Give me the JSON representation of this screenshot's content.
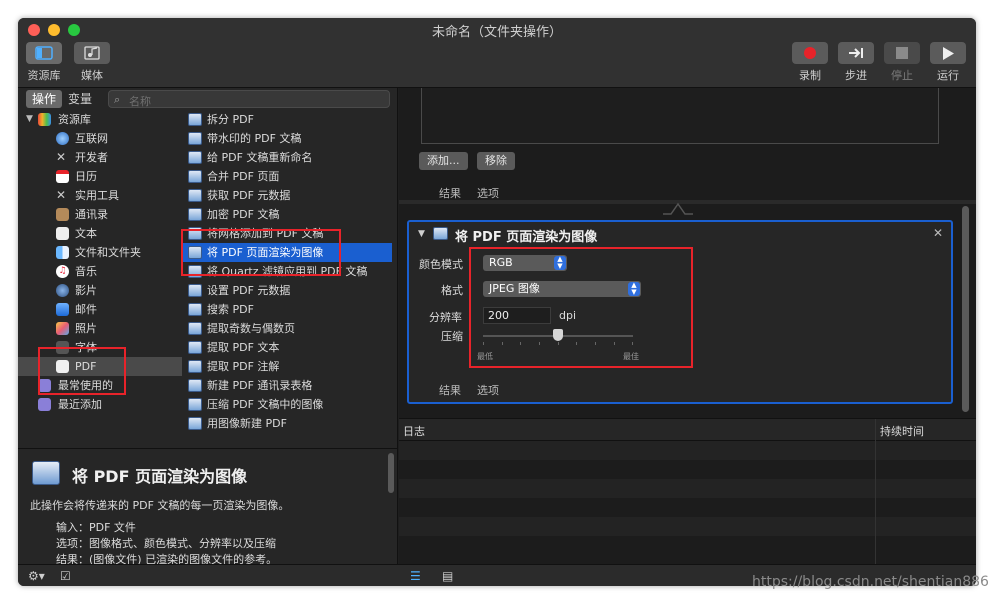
{
  "window": {
    "title": "未命名（文件夹操作）"
  },
  "toolbar": {
    "library_label": "资源库",
    "media_label": "媒体",
    "record_label": "录制",
    "step_label": "步进",
    "stop_label": "停止",
    "run_label": "运行"
  },
  "library": {
    "tab_actions": "操作",
    "tab_variables": "变量",
    "search_placeholder": "名称",
    "categories": [
      {
        "label": "资源库",
        "icon": "library-icon"
      },
      {
        "label": "互联网",
        "icon": "globe-icon"
      },
      {
        "label": "开发者",
        "icon": "tools-icon"
      },
      {
        "label": "日历",
        "icon": "calendar-icon"
      },
      {
        "label": "实用工具",
        "icon": "utilities-icon"
      },
      {
        "label": "通讯录",
        "icon": "contacts-icon"
      },
      {
        "label": "文本",
        "icon": "text-icon"
      },
      {
        "label": "文件和文件夹",
        "icon": "finder-icon"
      },
      {
        "label": "音乐",
        "icon": "music-icon"
      },
      {
        "label": "影片",
        "icon": "movie-icon"
      },
      {
        "label": "邮件",
        "icon": "mail-icon"
      },
      {
        "label": "照片",
        "icon": "photos-icon"
      },
      {
        "label": "字体",
        "icon": "fonts-icon"
      },
      {
        "label": "PDF",
        "icon": "pdf-icon"
      },
      {
        "label": "最常使用的",
        "icon": "folder-icon"
      },
      {
        "label": "最近添加",
        "icon": "folder-icon"
      }
    ],
    "actions": [
      "拆分 PDF",
      "带水印的 PDF 文稿",
      "给 PDF 文稿重新命名",
      "合并 PDF 页面",
      "获取 PDF 元数据",
      "加密 PDF 文稿",
      "将网格添加到 PDF 文稿",
      "将 PDF 页面渲染为图像",
      "将 Quartz 滤镜应用到 PDF 文稿",
      "设置 PDF 元数据",
      "搜索 PDF",
      "提取奇数与偶数页",
      "提取 PDF 文本",
      "提取 PDF 注解",
      "新建 PDF 通讯录表格",
      "压缩 PDF 文稿中的图像",
      "用图像新建 PDF"
    ]
  },
  "description": {
    "title": "将 PDF 页面渲染为图像",
    "body": "此操作会将传递来的 PDF 文稿的每一页渲染为图像。",
    "input": "输入：PDF 文件",
    "options": "选项：图像格式、颜色模式、分辨率以及压缩",
    "result": "结果：(图像文件) 已渲染的图像文件的参考。"
  },
  "workflow": {
    "add_button": "添加...",
    "remove_button": "移除",
    "prev_results_tab": "结果",
    "prev_options_tab": "选项",
    "action": {
      "title": "将 PDF 页面渲染为图像",
      "color_mode_label": "颜色模式",
      "color_mode_value": "RGB",
      "format_label": "格式",
      "format_value": "JPEG 图像",
      "resolution_label": "分辨率",
      "resolution_value": "200",
      "resolution_unit": "dpi",
      "compression_label": "压缩",
      "compression_level": 0.5,
      "compression_min": "最低",
      "compression_max": "最佳",
      "results_tab": "结果",
      "options_tab": "选项"
    }
  },
  "log": {
    "col_log": "日志",
    "col_duration": "持续时间"
  },
  "watermark": "https://blog.csdn.net/shentian886",
  "colors": {
    "selection": "#1a5fd0",
    "annotation": "#e8232a"
  }
}
